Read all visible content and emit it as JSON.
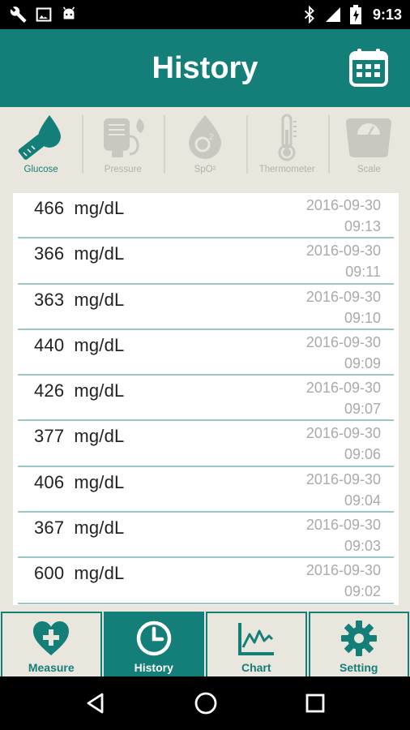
{
  "status_bar": {
    "time": "9:13",
    "icons_left": [
      "wrench-icon",
      "image-icon",
      "android-icon"
    ],
    "icons_right": [
      "bluetooth-icon",
      "signal-icon",
      "battery-icon"
    ]
  },
  "header": {
    "title": "History",
    "action_icon": "calendar-icon"
  },
  "categories": [
    {
      "label": "Glucose",
      "icon": "glucose-meter-icon",
      "active": true
    },
    {
      "label": "Pressure",
      "icon": "blood-pressure-icon",
      "active": false
    },
    {
      "label": "SpO²",
      "icon": "oxygen-drop-icon",
      "active": false
    },
    {
      "label": "Thermometer",
      "icon": "thermometer-icon",
      "active": false
    },
    {
      "label": "Scale",
      "icon": "scale-icon",
      "active": false
    }
  ],
  "records": [
    {
      "value": "466",
      "unit": "mg/dL",
      "date": "2016-09-30",
      "time": "09:13"
    },
    {
      "value": "366",
      "unit": "mg/dL",
      "date": "2016-09-30",
      "time": "09:11"
    },
    {
      "value": "363",
      "unit": "mg/dL",
      "date": "2016-09-30",
      "time": "09:10"
    },
    {
      "value": "440",
      "unit": "mg/dL",
      "date": "2016-09-30",
      "time": "09:09"
    },
    {
      "value": "426",
      "unit": "mg/dL",
      "date": "2016-09-30",
      "time": "09:07"
    },
    {
      "value": "377",
      "unit": "mg/dL",
      "date": "2016-09-30",
      "time": "09:06"
    },
    {
      "value": "406",
      "unit": "mg/dL",
      "date": "2016-09-30",
      "time": "09:04"
    },
    {
      "value": "367",
      "unit": "mg/dL",
      "date": "2016-09-30",
      "time": "09:03"
    },
    {
      "value": "600",
      "unit": "mg/dL",
      "date": "2016-09-30",
      "time": "09:02"
    }
  ],
  "bottom_nav": [
    {
      "label": "Measure",
      "icon": "heart-plus-icon",
      "active": false
    },
    {
      "label": "History",
      "icon": "clock-icon",
      "active": true
    },
    {
      "label": "Chart",
      "icon": "chart-icon",
      "active": false
    },
    {
      "label": "Setting",
      "icon": "gear-icon",
      "active": false
    }
  ],
  "android_nav": [
    "back-icon",
    "home-icon",
    "recents-icon"
  ],
  "colors": {
    "primary": "#147f78",
    "background": "#e9e6dd",
    "divider": "#9cc9c6",
    "muted_text": "#aaaaaa"
  }
}
